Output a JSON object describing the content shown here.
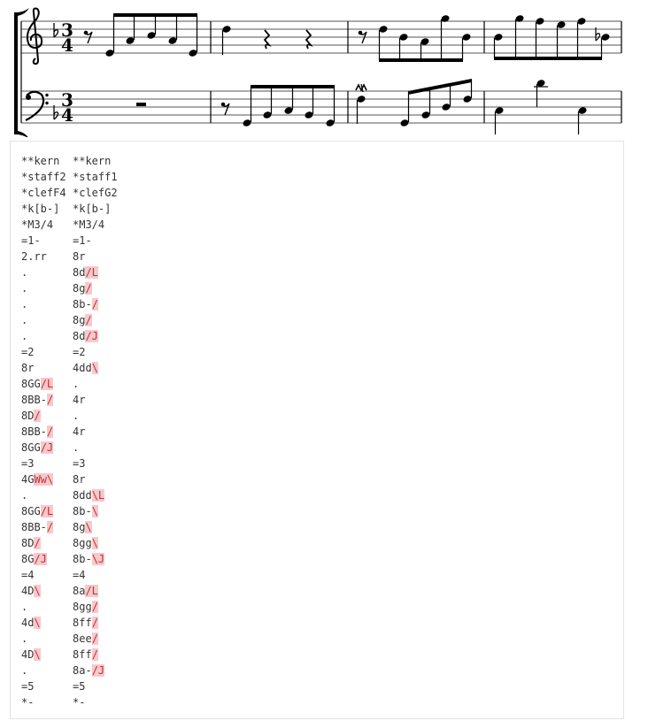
{
  "colors": {
    "ink": "#000000",
    "staff_line": "#555555",
    "code_text": "#333333",
    "markup_bg": "#f6c9cb",
    "markup_text": "#cc2b3a",
    "panel_border": "#e3e3e3"
  },
  "score": {
    "treble": {
      "clef": "treble-clef",
      "key_signature": "b-flat",
      "time_signature": {
        "top": "3",
        "bottom": "4"
      },
      "measures": [
        [
          "8r",
          "8d",
          "8g",
          "8b-",
          "8g",
          "8d"
        ],
        [
          "4dd",
          "4r",
          "4r"
        ],
        [
          "8r",
          "8dd",
          "8b-",
          "8g",
          "8gg",
          "8b-"
        ],
        [
          "8a",
          "8gg",
          "8ff",
          "8ee",
          "8ff",
          "8a-"
        ]
      ]
    },
    "bass": {
      "clef": "bass-clef",
      "key_signature": "b-flat",
      "time_signature": {
        "top": "3",
        "bottom": "4"
      },
      "measures": [
        [
          "2.rr"
        ],
        [
          "8r",
          "8GG",
          "8BB-",
          "8D",
          "8BB-",
          "8GG"
        ],
        [
          "4G(mordent)",
          "8GG",
          "8BB-",
          "8D",
          "8G"
        ],
        [
          "4D",
          "4d",
          "4D"
        ]
      ]
    }
  },
  "kern": {
    "rows": [
      [
        [
          "**kern"
        ],
        [
          "**kern"
        ]
      ],
      [
        [
          "*staff2"
        ],
        [
          "*staff1"
        ]
      ],
      [
        [
          "*clefF4"
        ],
        [
          "*clefG2"
        ]
      ],
      [
        [
          "*k[b-]"
        ],
        [
          "*k[b-]"
        ]
      ],
      [
        [
          "*M3/4"
        ],
        [
          "*M3/4"
        ]
      ],
      [
        [
          "=1-"
        ],
        [
          "=1-"
        ]
      ],
      [
        [
          "2.rr"
        ],
        [
          "8r"
        ]
      ],
      [
        [
          "."
        ],
        [
          "8d",
          "/L"
        ]
      ],
      [
        [
          "."
        ],
        [
          "8g",
          "/"
        ]
      ],
      [
        [
          "."
        ],
        [
          "8b-",
          "/"
        ]
      ],
      [
        [
          "."
        ],
        [
          "8g",
          "/"
        ]
      ],
      [
        [
          "."
        ],
        [
          "8d",
          "/J"
        ]
      ],
      [
        [
          "=2"
        ],
        [
          "=2"
        ]
      ],
      [
        [
          "8r"
        ],
        [
          "4dd",
          "\\"
        ]
      ],
      [
        [
          "8GG",
          "/L"
        ],
        [
          "."
        ]
      ],
      [
        [
          "8BB-",
          "/"
        ],
        [
          "4r"
        ]
      ],
      [
        [
          "8D",
          "/"
        ],
        [
          "."
        ]
      ],
      [
        [
          "8BB-",
          "/"
        ],
        [
          "4r"
        ]
      ],
      [
        [
          "8GG",
          "/J"
        ],
        [
          "."
        ]
      ],
      [
        [
          "=3"
        ],
        [
          "=3"
        ]
      ],
      [
        [
          "4G",
          "Ww\\"
        ],
        [
          "8r"
        ]
      ],
      [
        [
          "."
        ],
        [
          "8dd",
          "\\L"
        ]
      ],
      [
        [
          "8GG",
          "/L"
        ],
        [
          "8b-",
          "\\"
        ]
      ],
      [
        [
          "8BB-",
          "/"
        ],
        [
          "8g",
          "\\"
        ]
      ],
      [
        [
          "8D",
          "/"
        ],
        [
          "8gg",
          "\\"
        ]
      ],
      [
        [
          "8G",
          "/J"
        ],
        [
          "8b-",
          "\\J"
        ]
      ],
      [
        [
          "=4"
        ],
        [
          "=4"
        ]
      ],
      [
        [
          "4D",
          "\\"
        ],
        [
          "8a",
          "/L"
        ]
      ],
      [
        [
          "."
        ],
        [
          "8gg",
          "/"
        ]
      ],
      [
        [
          "4d",
          "\\"
        ],
        [
          "8ff",
          "/"
        ]
      ],
      [
        [
          "."
        ],
        [
          "8ee",
          "/"
        ]
      ],
      [
        [
          "4D",
          "\\"
        ],
        [
          "8ff",
          "/"
        ]
      ],
      [
        [
          "."
        ],
        [
          "8a-",
          "/J"
        ]
      ],
      [
        [
          "=5"
        ],
        [
          "=5"
        ]
      ],
      [
        [
          "*-"
        ],
        [
          "*-"
        ]
      ]
    ]
  }
}
